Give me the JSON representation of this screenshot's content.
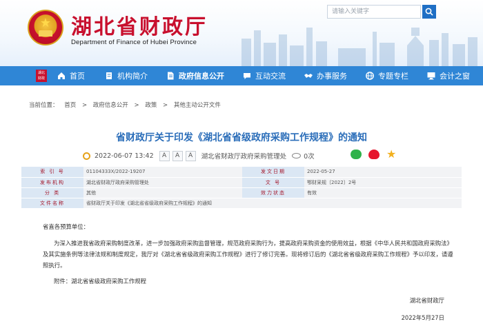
{
  "header": {
    "title": "湖北省财政厅",
    "subtitle": "Department of Finance of Hubei Province",
    "search_placeholder": "请输入关键字"
  },
  "nav": {
    "badge": "湖北 财政",
    "items": [
      {
        "label": "首页",
        "icon": "home-icon"
      },
      {
        "label": "机构简介",
        "icon": "building-icon"
      },
      {
        "label": "政府信息公开",
        "icon": "document-icon",
        "active": true
      },
      {
        "label": "互动交流",
        "icon": "chat-icon"
      },
      {
        "label": "办事服务",
        "icon": "handshake-icon"
      },
      {
        "label": "专题专栏",
        "icon": "globe-icon"
      },
      {
        "label": "会计之窗",
        "icon": "computer-icon"
      }
    ]
  },
  "breadcrumb": {
    "prefix": "当前位置：",
    "items": [
      "首页",
      "政府信息公开",
      "政策",
      "其他主动公开文件"
    ],
    "separator": ">"
  },
  "article": {
    "title": "省财政厅关于印发《湖北省省级政府采购工作规程》的通知",
    "date": "2022-06-07 13:42",
    "source": "湖北省财政厅政府采购管理处",
    "views": "0次",
    "font_buttons": [
      "A",
      "A",
      "A"
    ]
  },
  "info_table": [
    {
      "k1": "索 引 号",
      "v1": "01104333X/2022-19207",
      "k2": "发文日期",
      "v2": "2022-05-27"
    },
    {
      "k1": "发布机构",
      "v1": "湖北省财政厅政府采购管理处",
      "k2": "文 号",
      "v2": "鄂财采规〔2022〕2号"
    },
    {
      "k1": "分 类",
      "v1": "其他",
      "k2": "效力状态",
      "v2": "有效"
    },
    {
      "k1": "文件名称",
      "v1": "省财政厅关于印发《湖北省省级政府采购工作规程》的通知",
      "k2": "",
      "v2": ""
    }
  ],
  "body": {
    "salutation": "省直各预算单位：",
    "paragraph": "为深入推进我省政府采购制度改革，进一步加强政府采购监督管理，规范政府采购行为，提高政府采购资金的使用效益，根据《中华人民共和国政府采购法》及其实施条例等法律法规和制度规定，我厅对《湖北省省级政府采购工作规程》进行了修订完善。现将修订后的《湖北省省级政府采购工作规程》予以印发，请遵照执行。",
    "attachment": "附件：湖北省省级政府采购工作规程",
    "signature": "湖北省财政厅",
    "sign_date": "2022年5月27日"
  },
  "colors": {
    "nav_bg": "#2f86d6",
    "title_red": "#c8102e",
    "article_title": "#2a6db9"
  }
}
